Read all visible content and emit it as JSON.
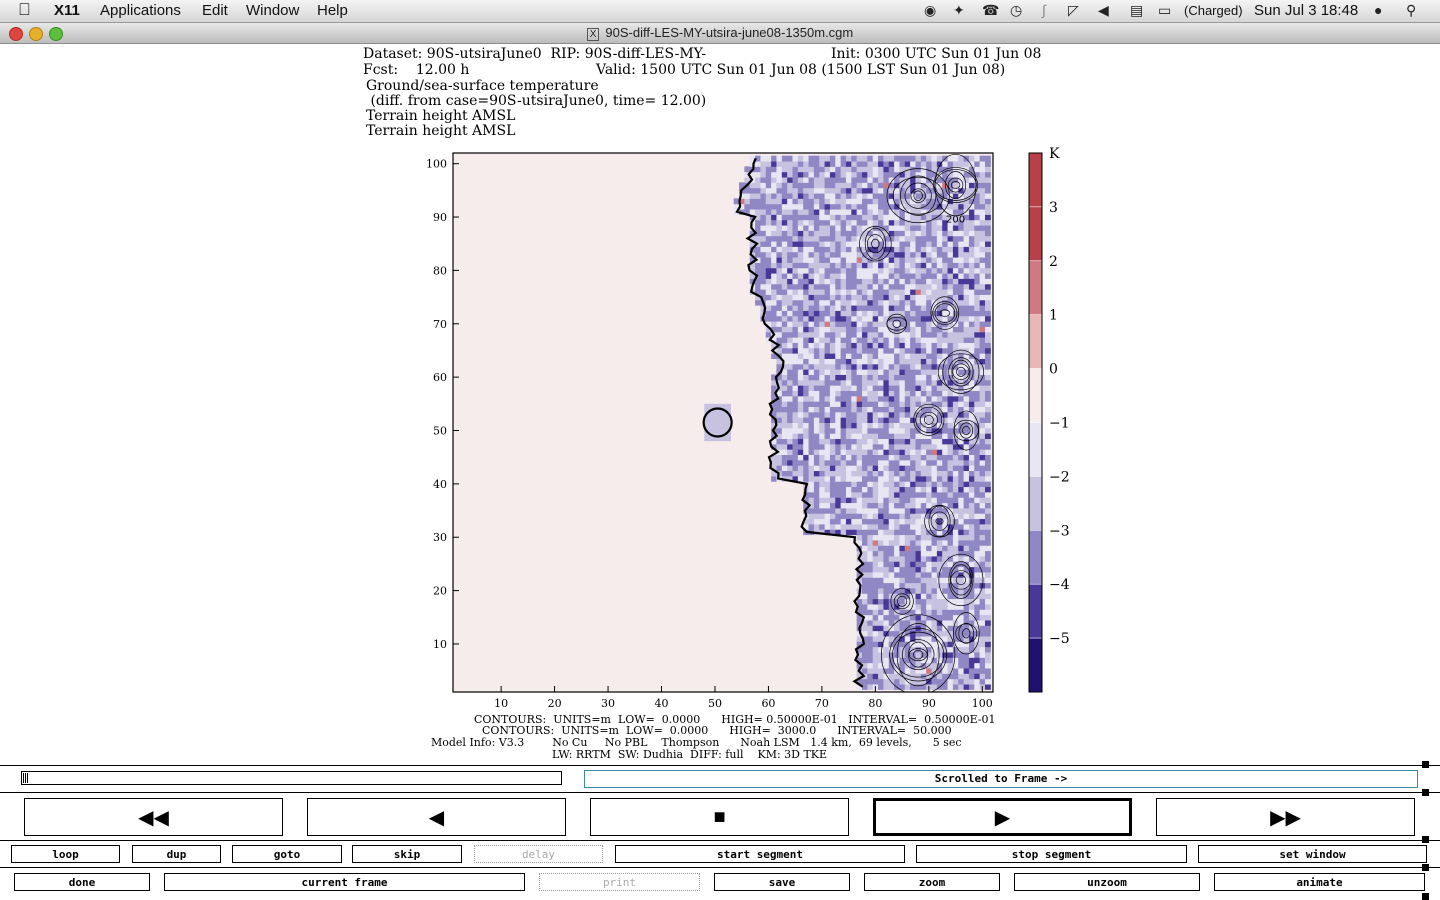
{
  "menubar": {
    "apple": "",
    "app": "X11",
    "items": [
      "Applications",
      "Edit",
      "Window",
      "Help"
    ],
    "battery": "(Charged)",
    "clock": "Sun Jul 3  18:48"
  },
  "window": {
    "title": "90S-diff-LES-MY-utsira-june08-1350m.cgm"
  },
  "header": {
    "line1a": "Dataset: 90S-utsiraJune0  RIP: 90S-diff-LES-MY-",
    "line1b": "Init: 0300 UTC Sun 01 Jun 08",
    "line2a": "Fcst:    12.00 h",
    "line2b": "Valid: 1500 UTC Sun 01 Jun 08 (1500 LST Sun 01 Jun 08)",
    "line3": "Ground/sea-surface temperature",
    "line4": " (diff. from case=90S-utsiraJune0, time= 12.00)",
    "line5": "Terrain height AMSL",
    "line6": "Terrain height AMSL"
  },
  "chart_data": {
    "type": "heatmap",
    "title": "Ground/sea-surface temperature",
    "x_ticks": [
      "10",
      "20",
      "30",
      "40",
      "50",
      "60",
      "70",
      "80",
      "90",
      "100"
    ],
    "y_ticks": [
      "10",
      "20",
      "30",
      "40",
      "50",
      "60",
      "70",
      "80",
      "90",
      "100"
    ],
    "xlim": [
      1,
      102
    ],
    "ylim": [
      1,
      102
    ],
    "colorbar": {
      "unit": "K",
      "labels": [
        "3",
        "2",
        "1",
        "0",
        "−1",
        "−2",
        "−3",
        "−4",
        "−5"
      ],
      "colors": [
        "#b84048",
        "#cf7a80",
        "#e8b8b8",
        "#f6ecec",
        "#e8e6f2",
        "#c6c2e0",
        "#9088c4",
        "#4a3898",
        "#201070"
      ]
    },
    "contour_label": "200"
  },
  "footer": {
    "line1": "CONTOURS:  UNITS=m  LOW=  0.0000      HIGH= 0.50000E-01   INTERVAL=  0.50000E-01",
    "line2": "CONTOURS:  UNITS=m  LOW=  0.0000      HIGH=  3000.0      INTERVAL=  50.000",
    "line3": "Model Info: V3.3        No Cu     No PBL    Thompson      Noah LSM   1.4 km,  69 levels,      5 sec",
    "line4": "LW: RRTM  SW: Dudhia  DIFF: full    KM: 3D TKE"
  },
  "controls": {
    "status": "Scrolled to Frame ->",
    "row1": [
      "loop",
      "dup",
      "goto",
      "skip",
      "delay",
      "start segment",
      "stop segment",
      "set window"
    ],
    "row2": [
      "done",
      "current frame",
      "print",
      "save",
      "zoom",
      "unzoom",
      "animate"
    ],
    "nav": [
      "◀◀",
      "◀",
      "■",
      "▶",
      "▶▶"
    ]
  }
}
